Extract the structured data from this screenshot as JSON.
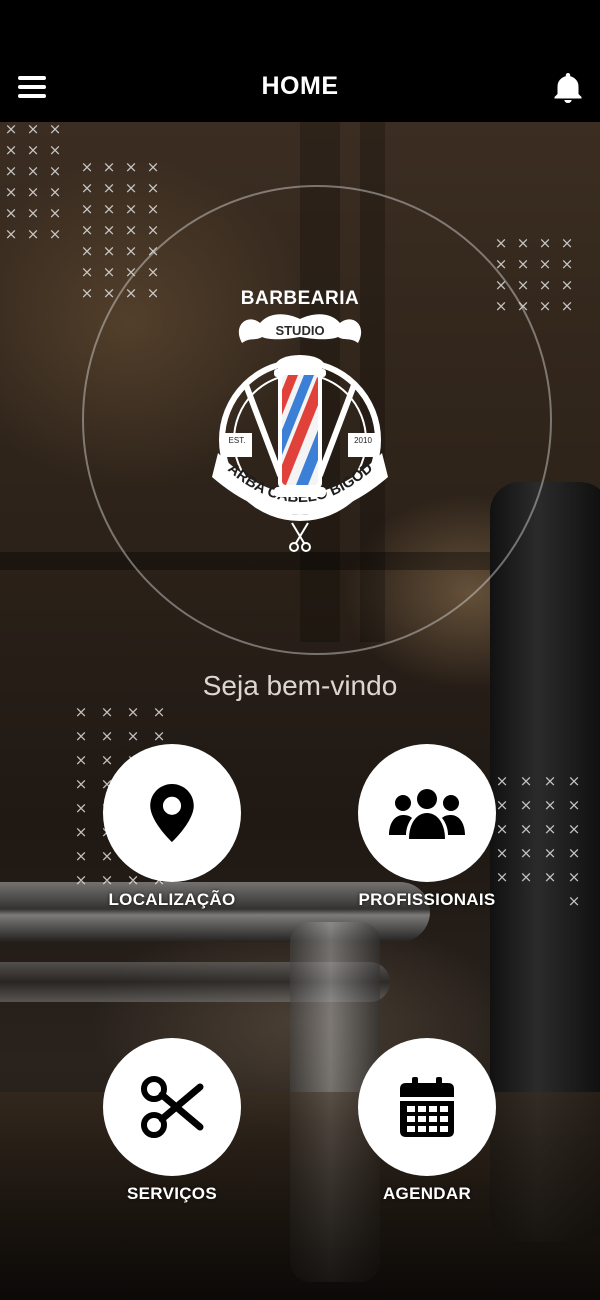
{
  "header": {
    "title": "HOME",
    "menu_icon": "hamburger-menu-icon",
    "notification_icon": "bell-icon"
  },
  "logo": {
    "top_text": "BARBEARIA",
    "banner_text": "STUDIO",
    "ring_text": "BARBA CABELO BIGODE",
    "est_label": "EST.",
    "year": "2010"
  },
  "welcome_text": "Seja bem-vindo",
  "menu": [
    {
      "label": "LOCALIZAÇÃO",
      "icon": "map-pin-icon"
    },
    {
      "label": "PROFISSIONAIS",
      "icon": "users-icon"
    },
    {
      "label": "SERVIÇOS",
      "icon": "scissors-icon"
    },
    {
      "label": "AGENDAR",
      "icon": "calendar-icon"
    }
  ],
  "colors": {
    "header_bg": "#000000",
    "button_bg": "#ffffff",
    "icon_color": "#000000",
    "text_color": "#ffffff",
    "barber_pole_red": "#e0413a",
    "barber_pole_blue": "#3b7fd6"
  }
}
